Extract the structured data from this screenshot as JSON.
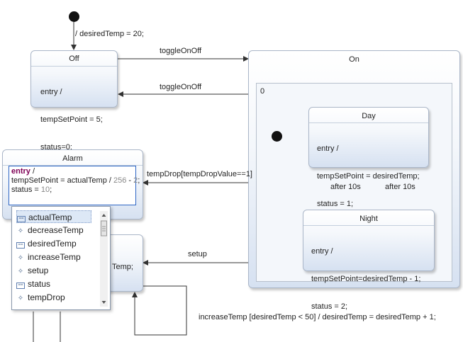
{
  "initial_transition": {
    "label": "/ desiredTemp = 20;"
  },
  "states": {
    "off": {
      "name": "Off",
      "body": [
        "entry /",
        "tempSetPoint = 5;",
        "status=0;"
      ]
    },
    "on": {
      "name": "On",
      "region_label": "0"
    },
    "day": {
      "name": "Day",
      "body": [
        "entry /",
        "tempSetPoint = desiredTemp;",
        "status = 1;"
      ]
    },
    "night": {
      "name": "Night",
      "body": [
        "entry /",
        "tempSetPoint=desiredTemp - 1;",
        "status = 2;"
      ]
    },
    "alarm": {
      "name": "Alarm"
    },
    "lower": {
      "body_fragment": "Temp;"
    }
  },
  "editor": {
    "line1_kw": "entry",
    "line1_rest": " /",
    "line2_a": "tempSetPoint = actualTemp / ",
    "line2_n1": "256",
    "line2_b": " - ",
    "line2_n2": "2",
    "line2_c": ";",
    "line3_a": "status = ",
    "line3_n": "10",
    "line3_c": ";"
  },
  "transitions": {
    "off_to_on": "toggleOnOff",
    "on_to_off": "toggleOnOff",
    "on_to_alarm": "tempDrop[tempDropValue==1]",
    "day_to_night": "after 10s",
    "night_to_day": "after 10s",
    "on_to_lower": "setup",
    "self_loop": "increaseTemp [desiredTemp < 50] / desiredTemp = desiredTemp + 1;"
  },
  "autocomplete": {
    "items": [
      {
        "label": "actualTemp",
        "icon": "variable-icon",
        "selected": true
      },
      {
        "label": "decreaseTemp",
        "icon": "event-icon"
      },
      {
        "label": "desiredTemp",
        "icon": "variable-icon"
      },
      {
        "label": "increaseTemp",
        "icon": "event-icon"
      },
      {
        "label": "setup",
        "icon": "event-icon"
      },
      {
        "label": "status",
        "icon": "variable-icon"
      },
      {
        "label": "tempDrop",
        "icon": "event-icon"
      }
    ]
  }
}
